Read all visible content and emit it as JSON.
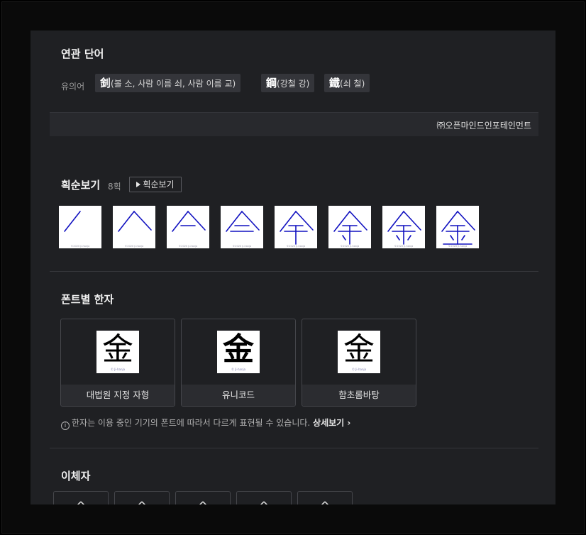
{
  "related": {
    "title": "연관 단어",
    "synonym_label": "유의어",
    "synonyms": [
      {
        "hanja": "釗",
        "reading": "(볼 소, 사람 이름 쇠, 사람 이름 교)"
      },
      {
        "hanja": "鋼",
        "reading": "(강철 강)"
      },
      {
        "hanja": "鐵",
        "reading": "(쇠 철)"
      }
    ]
  },
  "credit": "㈜오픈마인드인포테인먼트",
  "stroke_order": {
    "title": "획순보기",
    "count": "8획",
    "button_label": "획순보기",
    "frames": [
      1,
      2,
      3,
      4,
      5,
      6,
      7,
      8
    ],
    "watermark": "©2020 ji-hanja"
  },
  "fonts": {
    "title": "폰트별 한자",
    "glyph": "金",
    "watermark": "© Ji-hanja",
    "cards": [
      {
        "caption": "대법원 지정 자형"
      },
      {
        "caption": "유니코드"
      },
      {
        "caption": "함초롬바탕"
      }
    ],
    "notice": "한자는 이용 중인 기기의 폰트에 따라서 다르게 표현될 수 있습니다.",
    "detail_link": "상세보기"
  },
  "variants": {
    "title": "이체자",
    "count": 5
  },
  "colors": {
    "panel_bg": "#1f2023",
    "stroke_blue": "#1010c0",
    "chip_bg": "#34353a"
  }
}
